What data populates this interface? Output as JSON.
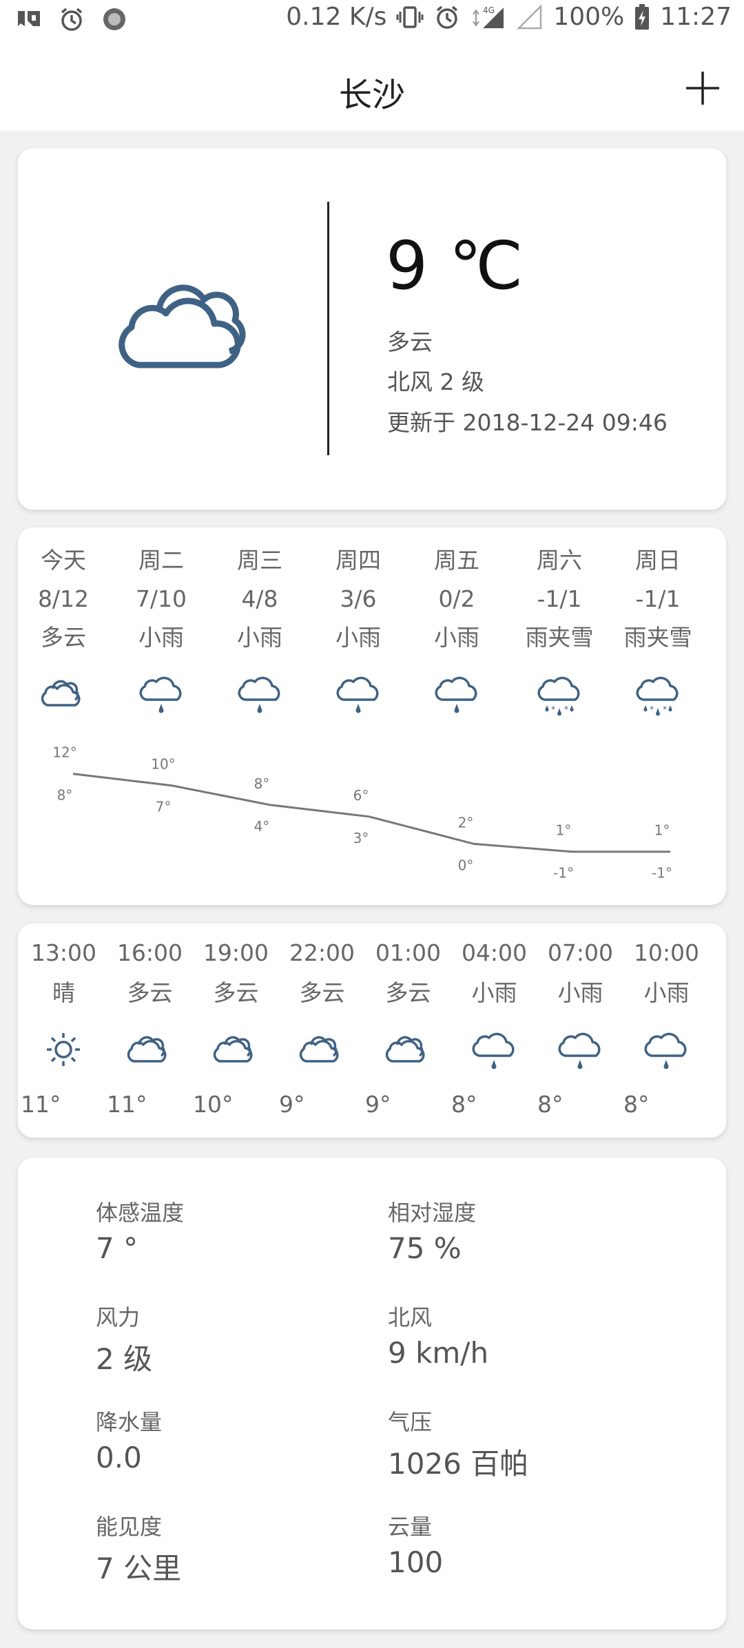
{
  "status_bar": {
    "network_speed": "0.12 K/s",
    "network_type": "4G",
    "battery": "100%",
    "time": "11:27"
  },
  "app_bar": {
    "city": "长沙"
  },
  "current": {
    "temperature": "9 ℃",
    "condition": "多云",
    "wind": "北风 2 级",
    "updated": "更新于 2018-12-24 09:46",
    "icon": "cloudy-icon"
  },
  "daily": [
    {
      "day": "今天",
      "range": "8/12",
      "desc": "多云",
      "icon": "cloudy",
      "high": "12°",
      "low": "8°"
    },
    {
      "day": "周二",
      "range": "7/10",
      "desc": "小雨",
      "icon": "rain",
      "high": "10°",
      "low": "7°"
    },
    {
      "day": "周三",
      "range": "4/8",
      "desc": "小雨",
      "icon": "rain",
      "high": "8°",
      "low": "4°"
    },
    {
      "day": "周四",
      "range": "3/6",
      "desc": "小雨",
      "icon": "rain",
      "high": "6°",
      "low": "3°"
    },
    {
      "day": "周五",
      "range": "0/2",
      "desc": "小雨",
      "icon": "rain",
      "high": "2°",
      "low": "0°"
    },
    {
      "day": "周六",
      "range": "-1/1",
      "desc": "雨夹雪",
      "icon": "sleet",
      "high": "1°",
      "low": "-1°"
    },
    {
      "day": "周日",
      "range": "-1/1",
      "desc": "雨夹雪",
      "icon": "sleet",
      "high": "1°",
      "low": "-1°"
    }
  ],
  "chart_data": {
    "type": "line",
    "categories": [
      "今天",
      "周二",
      "周三",
      "周四",
      "周五",
      "周六",
      "周日"
    ],
    "series": [
      {
        "values": [
          12,
          10,
          8,
          6,
          2,
          1,
          1
        ]
      },
      {
        "values": [
          8,
          7,
          4,
          3,
          0,
          -1,
          -1
        ]
      }
    ]
  },
  "hourly": [
    {
      "time": "13:00",
      "desc": "晴",
      "icon": "sunny",
      "temp": "11°"
    },
    {
      "time": "16:00",
      "desc": "多云",
      "icon": "cloudy",
      "temp": "11°"
    },
    {
      "time": "19:00",
      "desc": "多云",
      "icon": "cloudy",
      "temp": "10°"
    },
    {
      "time": "22:00",
      "desc": "多云",
      "icon": "cloudy",
      "temp": "9°"
    },
    {
      "time": "01:00",
      "desc": "多云",
      "icon": "cloudy",
      "temp": "9°"
    },
    {
      "time": "04:00",
      "desc": "小雨",
      "icon": "rain",
      "temp": "8°"
    },
    {
      "time": "07:00",
      "desc": "小雨",
      "icon": "rain",
      "temp": "8°"
    },
    {
      "time": "10:00",
      "desc": "小雨",
      "icon": "rain",
      "temp": "8°"
    }
  ],
  "details": [
    {
      "label": "体感温度",
      "value": "7 °"
    },
    {
      "label": "相对湿度",
      "value": "75 %"
    },
    {
      "label": "风力",
      "value": "2 级"
    },
    {
      "label": "北风",
      "value": "9 km/h"
    },
    {
      "label": "降水量",
      "value": "0.0"
    },
    {
      "label": "气压",
      "value": "1026 百帕"
    },
    {
      "label": "能见度",
      "value": "7 公里"
    },
    {
      "label": "云量",
      "value": "100"
    }
  ],
  "colors": {
    "icon": "#3f6284",
    "line": "#777777"
  }
}
